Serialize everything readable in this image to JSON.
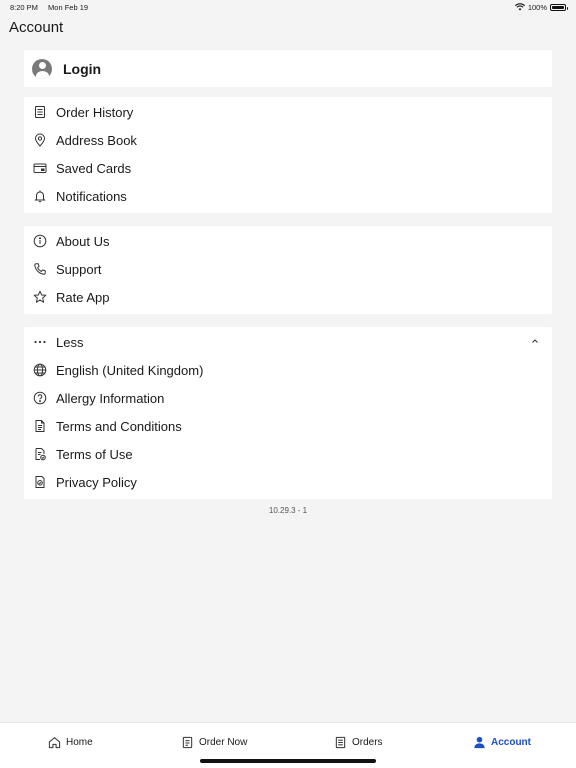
{
  "status_bar": {
    "time": "8:20 PM",
    "date": "Mon Feb 19",
    "battery": "100%"
  },
  "page": {
    "title": "Account"
  },
  "login": {
    "label": "Login"
  },
  "group1": [
    {
      "label": "Order History",
      "icon": "receipt-icon"
    },
    {
      "label": "Address Book",
      "icon": "map-pin-icon"
    },
    {
      "label": "Saved Cards",
      "icon": "credit-card-icon"
    },
    {
      "label": "Notifications",
      "icon": "bell-icon"
    }
  ],
  "group2": [
    {
      "label": "About Us",
      "icon": "info-icon"
    },
    {
      "label": "Support",
      "icon": "phone-icon"
    },
    {
      "label": "Rate App",
      "icon": "star-icon"
    }
  ],
  "group3": [
    {
      "label": "Less",
      "icon": "more-dots-icon"
    },
    {
      "label": "English (United Kingdom)",
      "icon": "globe-icon"
    },
    {
      "label": "Allergy Information",
      "icon": "question-icon"
    },
    {
      "label": "Terms and Conditions",
      "icon": "document-icon"
    },
    {
      "label": "Terms of Use",
      "icon": "document-check-icon"
    },
    {
      "label": "Privacy Policy",
      "icon": "privacy-icon"
    }
  ],
  "version": "10.29.3 - 1",
  "tabbar": {
    "home": "Home",
    "order_now": "Order Now",
    "orders": "Orders",
    "account": "Account",
    "active_color": "#1c4fc4"
  }
}
